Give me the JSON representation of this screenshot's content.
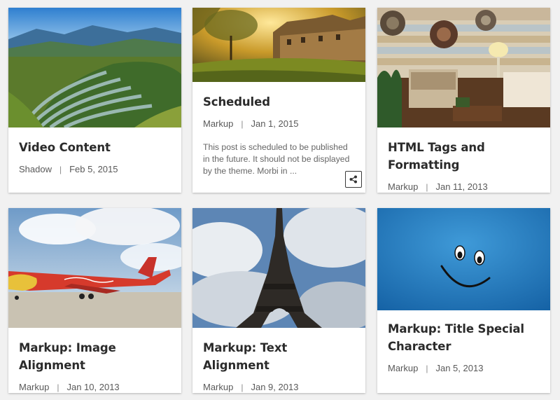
{
  "posts": [
    {
      "title": "Video Content",
      "category": "Shadow",
      "date": "Feb 5, 2015",
      "image": "rice-terraces"
    },
    {
      "title": "Scheduled",
      "category": "Markup",
      "date": "Jan 1, 2015",
      "image": "sunlit-village",
      "excerpt": "This post is scheduled to be published in the future. It should not be displayed by the theme. Morbi in ...",
      "share_icon": "share-icon"
    },
    {
      "title": "HTML Tags and Formatting",
      "category": "Markup",
      "date": "Jan 11, 2013",
      "image": "living-room"
    },
    {
      "title": "Markup: Image Alignment",
      "category": "Markup",
      "date": "Jan 10, 2013",
      "image": "airplane"
    },
    {
      "title": "Markup: Text Alignment",
      "category": "Markup",
      "date": "Jan 9, 2013",
      "image": "eiffel-tower"
    },
    {
      "title": "Markup: Title Special Character",
      "category": "Markup",
      "date": "Jan 5, 2013",
      "image": "smiley-face"
    }
  ],
  "meta_separator": "|",
  "colors": {
    "background": "#f1f1f1",
    "card": "#ffffff",
    "title": "#2b2b2b",
    "meta": "#595959",
    "excerpt": "#666666"
  }
}
